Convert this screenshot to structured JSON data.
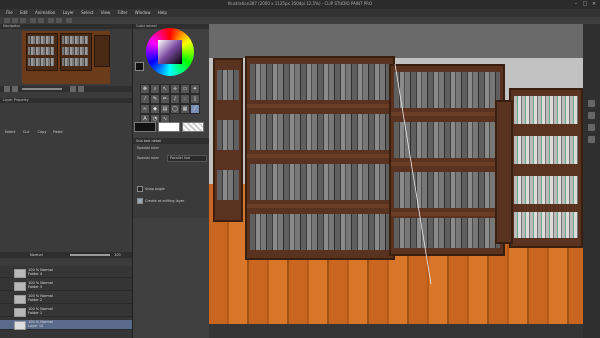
{
  "window": {
    "title": "Illustration387 (2000 x 1125px 350dpi 12.5%) - CLIP STUDIO PAINT PRO"
  },
  "menu": {
    "items": [
      "File",
      "Edit",
      "Animation",
      "Layer",
      "Select",
      "View",
      "Filter",
      "Window",
      "Help"
    ]
  },
  "panels": {
    "navigator_tab": "Navigator",
    "color_tab": "Color wheel",
    "layer_property_tab": "Layer Property",
    "tool_property_tab": "Sub tool detail",
    "tool_name": "Special ruler",
    "special_ruler_label": "Special ruler",
    "special_ruler_value": "Parallel line",
    "snap_label": "Snap angle",
    "create_label": "Create at editing layer",
    "layer_blend": "Normal",
    "layer_opacity": "100"
  },
  "layers": [
    {
      "line1": "100 % Normal",
      "line2": "Folder 4"
    },
    {
      "line1": "100 % Normal",
      "line2": "Folder 3"
    },
    {
      "line1": "100 % Normal",
      "line2": "Folder 2"
    },
    {
      "line1": "100 % Normal",
      "line2": "Folder 1"
    },
    {
      "line1": "100 % Normal",
      "line2": "Layer 10"
    }
  ],
  "edit_buttons": [
    "Select",
    "Cut",
    "Copy",
    "Paste"
  ]
}
